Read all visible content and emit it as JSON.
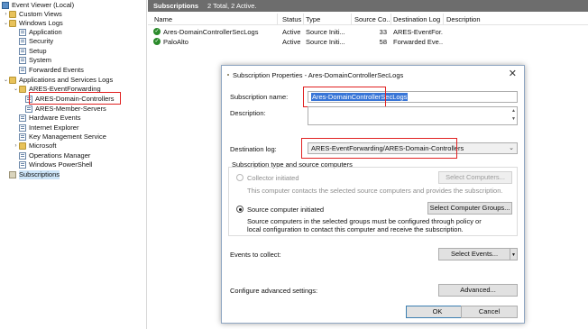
{
  "tree": {
    "items": [
      {
        "label": "Event Viewer (Local)"
      },
      {
        "label": "Custom Views"
      },
      {
        "label": "Windows Logs"
      },
      {
        "label": "Application"
      },
      {
        "label": "Security"
      },
      {
        "label": "Setup"
      },
      {
        "label": "System"
      },
      {
        "label": "Forwarded Events"
      },
      {
        "label": "Applications and Services Logs"
      },
      {
        "label": "ARES-EventForwarding"
      },
      {
        "label": "ARES-Domain-Controllers"
      },
      {
        "label": "ARES-Member-Servers"
      },
      {
        "label": "Hardware Events"
      },
      {
        "label": "Internet Explorer"
      },
      {
        "label": "Key Management Service"
      },
      {
        "label": "Microsoft"
      },
      {
        "label": "Operations Manager"
      },
      {
        "label": "Windows PowerShell"
      },
      {
        "label": "Subscriptions"
      }
    ]
  },
  "header": {
    "title": "Subscriptions",
    "summary": "2 Total, 2 Active."
  },
  "columns": [
    "Name",
    "Status",
    "Type",
    "Source Co...",
    "Destination Log",
    "Description"
  ],
  "rows": [
    {
      "name": "Ares-DomainControllerSecLogs",
      "status": "Active",
      "type": "Source Initi...",
      "count": "33",
      "dest": "ARES-EventFor...",
      "desc": ""
    },
    {
      "name": "PaloAlto",
      "status": "Active",
      "type": "Source Initi...",
      "count": "58",
      "dest": "Forwarded Eve...",
      "desc": ""
    }
  ],
  "dialog": {
    "title": "Subscription Properties - Ares-DomainControllerSecLogs",
    "close": "✕",
    "name_label": "Subscription name:",
    "name_value": "Ares-DomainControllerSecLogs",
    "desc_label": "Description:",
    "desc_value": "",
    "dest_label": "Destination log:",
    "dest_value": "ARES-EventForwarding/ARES-Domain-Controllers",
    "group_label": "Subscription type and source computers",
    "collector_label": "Collector initiated",
    "select_computers": "Select Computers...",
    "collector_desc": "This computer contacts the selected source computers and provides the subscription.",
    "source_label": "Source computer initiated",
    "select_groups": "Select Computer Groups...",
    "source_desc_1": "Source computers in the selected groups must be configured through policy or",
    "source_desc_2": "local configuration to contact this computer and receive the subscription.",
    "events_label": "Events to collect:",
    "select_events": "Select Events...",
    "advanced_label": "Configure advanced settings:",
    "advanced_btn": "Advanced...",
    "ok": "OK",
    "cancel": "Cancel"
  },
  "colors": {
    "highlight_box": "#e02020",
    "selection": "#3875d7",
    "header_bg": "#6d6d6d"
  }
}
